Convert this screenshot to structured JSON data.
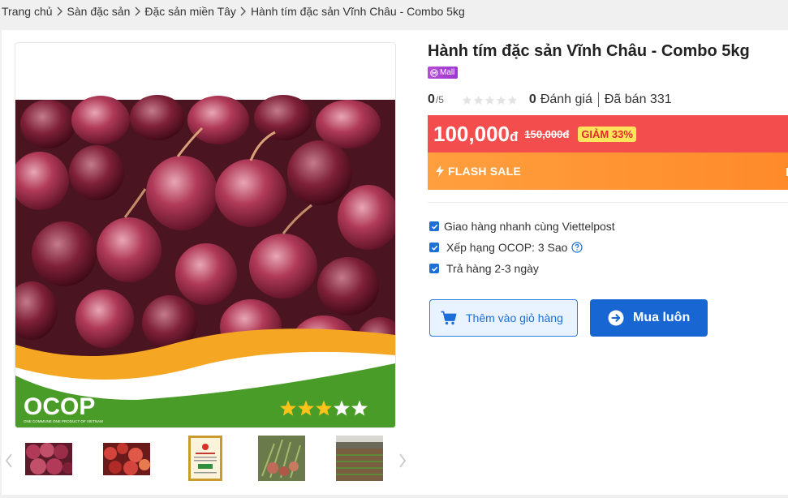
{
  "breadcrumb": [
    {
      "label": "Trang chủ"
    },
    {
      "label": "Sàn đặc sản"
    },
    {
      "label": "Đặc sản miền Tây"
    },
    {
      "label": "Hành tím đặc sản Vĩnh Châu - Combo 5kg"
    }
  ],
  "product": {
    "title": "Hành tím đặc sản Vĩnh Châu - Combo 5kg",
    "mall_badge": "Mall",
    "rating_score": "0",
    "rating_scale": "/5",
    "rating_stars_filled": 0,
    "rating_count": "0",
    "rating_label": "Đánh giá",
    "sold_label": "Đã bán 331",
    "price_now": "100,000",
    "currency": "đ",
    "price_old": "150,000đ",
    "discount": "GIẢM 33%",
    "flash_sale": "FLASH SALE"
  },
  "image": {
    "ocop_logo": "OCOP",
    "ocop_tagline": "ONE COMMUNE ONE PRODUCT OF VIETNAM",
    "ocop_stars_filled": 3,
    "ocop_stars_total": 5
  },
  "thumbnails": [
    {
      "icon": "shallots-thumbnail"
    },
    {
      "icon": "red-onions-thumbnail"
    },
    {
      "icon": "certificate-thumbnail"
    },
    {
      "icon": "harvest-thumbnail"
    },
    {
      "icon": "field-thumbnail"
    }
  ],
  "features": [
    {
      "label": "Giao hàng nhanh cùng Viettelpost"
    },
    {
      "label": "Xếp hạng OCOP: 3 Sao"
    },
    {
      "label": "Trả hàng 2-3 ngày"
    }
  ],
  "actions": {
    "add_to_cart": "Thêm vào giỏ hàng",
    "buy_now": "Mua luôn"
  },
  "colors": {
    "price_bar": "#f44d4d",
    "flash_bar": "#ff9f3e",
    "primary": "#1766d1",
    "mall": "#b64ad8"
  }
}
